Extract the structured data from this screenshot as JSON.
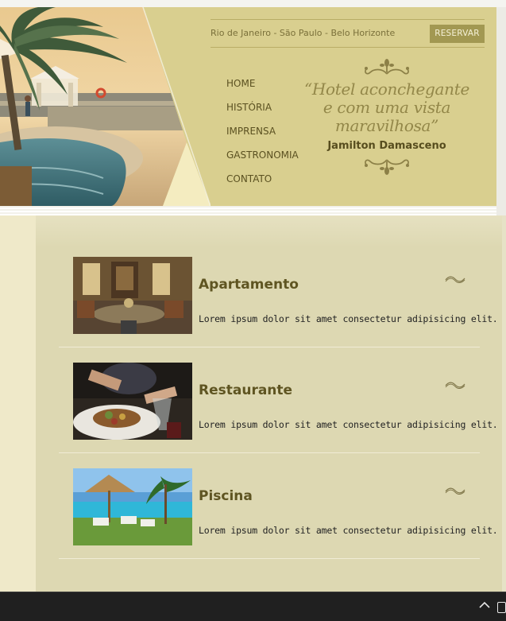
{
  "header": {
    "cities": "Rio de Janeiro - São Paulo - Belo Horizonte",
    "reserve_label": "RESERVAR",
    "nav": [
      "HOME",
      "HISTÓRIA",
      "IMPRENSA",
      "GASTRONOMIA",
      "CONTATO"
    ],
    "quote": "“Hotel aconchegante e com uma vista maravilhosa”",
    "quote_lines": [
      "“Hotel aconchegante",
      "e com uma vista",
      "maravilhosa”"
    ],
    "author": "Jamilton Damasceno"
  },
  "items": [
    {
      "title": "Apartamento",
      "text": "Lorem ipsum dolor sit amet consectetur adipisicing elit."
    },
    {
      "title": "Restaurante",
      "text": "Lorem ipsum dolor sit amet consectetur adipisicing elit."
    },
    {
      "title": "Piscina",
      "text": "Lorem ipsum dolor sit amet consectetur adipisicing elit."
    }
  ],
  "colors": {
    "header_bg": "#d9cf8f",
    "accent": "#a29852",
    "content_bg": "#ddd8b2",
    "title": "#5f5522"
  },
  "icons": {
    "ornament": "flourish-ornament-icon",
    "squiggle": "wave-ornament-icon",
    "tray": "chevron-up-icon"
  }
}
